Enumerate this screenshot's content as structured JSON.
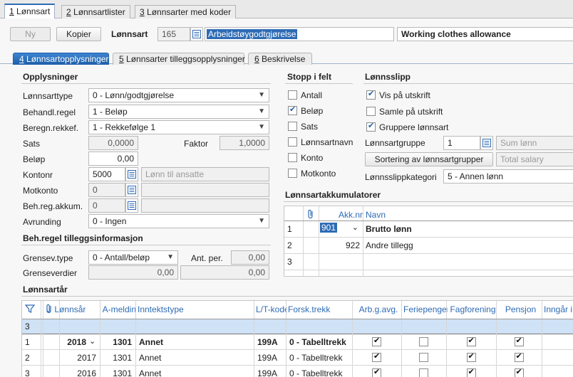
{
  "top_tabs": [
    {
      "key": "1",
      "label": "Lønnsart"
    },
    {
      "key": "2",
      "label": "Lønnsartlister"
    },
    {
      "key": "3",
      "label": "Lønnsarter med koder"
    }
  ],
  "toolbar": {
    "new_label": "Ny",
    "copy_label": "Kopier",
    "lonnsart_label": "Lønnsart",
    "lonnsart_number": "165",
    "lonnsart_name": "Arbeidstøygodtgjørelse",
    "lonnsart_english": "Working clothes allowance"
  },
  "sub_tabs": [
    {
      "key": "4",
      "label": "Lønnsartopplysninger"
    },
    {
      "key": "5",
      "label": "Lønnsarter tilleggsopplysninger"
    },
    {
      "key": "6",
      "label": "Beskrivelse"
    }
  ],
  "opplysninger": {
    "title": "Opplysninger",
    "lonnsarttype_label": "Lønnsarttype",
    "lonnsarttype_value": "0 - Lønn/godtgjørelse",
    "behandl_label": "Behandl.regel",
    "behandl_value": "1 - Beløp",
    "beregn_label": "Beregn.rekkef.",
    "beregn_value": "1 - Rekkefølge 1",
    "sats_label": "Sats",
    "sats_value": "0,0000",
    "faktor_label": "Faktor",
    "faktor_value": "1,0000",
    "belop_label": "Beløp",
    "belop_value": "0,00",
    "kontonr_label": "Kontonr",
    "kontonr_value": "5000",
    "kontonr_desc": "Lønn til ansatte",
    "motkonto_label": "Motkonto",
    "motkonto_value": "0",
    "behreg_label": "Beh.reg.akkum.",
    "behreg_value": "0",
    "avrunding_label": "Avrunding",
    "avrunding_value": "0 - Ingen"
  },
  "tillegg": {
    "title": "Beh.regel tilleggsinformasjon",
    "grensev_label": "Grensev.type",
    "grensev_value": "0 - Antall/beløp",
    "antper_label": "Ant. per.",
    "antper_value": "0,00",
    "grenseverdier_label": "Grenseverdier",
    "grenseverdier_1": "0,00",
    "grenseverdier_2": "0,00"
  },
  "stopp": {
    "title": "Stopp i felt",
    "items": [
      {
        "label": "Antall",
        "checked": false
      },
      {
        "label": "Beløp",
        "checked": true
      },
      {
        "label": "Sats",
        "checked": false
      },
      {
        "label": "Lønnsartnavn",
        "checked": false
      },
      {
        "label": "Konto",
        "checked": false
      },
      {
        "label": "Motkonto",
        "checked": false
      }
    ]
  },
  "lonnsslipp": {
    "title": "Lønnsslipp",
    "vis": {
      "label": "Vis på utskrift",
      "checked": true
    },
    "samle": {
      "label": "Samle på utskrift",
      "checked": false
    },
    "gruppere": {
      "label": "Gruppere lønnsart",
      "checked": true
    },
    "gruppe_label": "Lønnsartgruppe",
    "gruppe_value": "1",
    "gruppe_desc": "Sum lønn",
    "sortering_button": "Sortering av lønnsartgrupper",
    "total_desc": "Total salary",
    "kategori_label": "Lønnsslippkategori",
    "kategori_value": "5 - Annen lønn"
  },
  "akkumulatorer": {
    "title": "Lønnsartakkumulatorer",
    "col_akknr": "Akk.nr",
    "col_navn": "Navn",
    "rows": [
      {
        "n": "1",
        "akknr": "901",
        "navn": "Brutto lønn"
      },
      {
        "n": "2",
        "akknr": "922",
        "navn": "Andre tillegg"
      },
      {
        "n": "3",
        "akknr": "",
        "navn": ""
      }
    ]
  },
  "lonnsartar": {
    "title": "Lønnsartår",
    "headers": [
      "Lønnsår",
      "A-meldin",
      "Inntektstype",
      "L/T-kode",
      "Forsk.trekk",
      "Arb.g.avg.",
      "Feriepenger",
      "Fagforening",
      "Pensjon",
      "Inngår i g"
    ],
    "filter_row_n": "3",
    "rows": [
      {
        "n": "1",
        "year": "2018",
        "a": "1301",
        "type": "Annet",
        "lt": "199A",
        "forsk": "0 - Tabelltrekk",
        "arb": true,
        "ferie": false,
        "fag": true,
        "pensjon": true
      },
      {
        "n": "2",
        "year": "2017",
        "a": "1301",
        "type": "Annet",
        "lt": "199A",
        "forsk": "0 - Tabelltrekk",
        "arb": true,
        "ferie": false,
        "fag": true,
        "pensjon": true
      },
      {
        "n": "3",
        "year": "2016",
        "a": "1301",
        "type": "Annet",
        "lt": "199A",
        "forsk": "0 - Tabelltrekk",
        "arb": true,
        "ferie": false,
        "fag": true,
        "pensjon": true
      }
    ]
  }
}
